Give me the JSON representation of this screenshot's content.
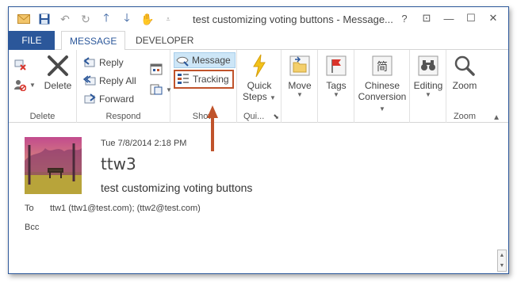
{
  "window": {
    "title": "test customizing voting buttons - Message...",
    "controls": [
      "?",
      "⊡",
      "—",
      "☐",
      "✕"
    ]
  },
  "tabs": [
    {
      "label": "FILE"
    },
    {
      "label": "MESSAGE"
    },
    {
      "label": "DEVELOPER"
    }
  ],
  "ribbon": {
    "delete_group": {
      "label": "Delete",
      "delete_button": "Delete"
    },
    "respond_group": {
      "label": "Respond",
      "reply": "Reply",
      "reply_all": "Reply All",
      "forward": "Forward"
    },
    "show_group": {
      "label": "Show",
      "message": "Message",
      "tracking": "Tracking"
    },
    "quicksteps_group": {
      "label": "Qui...",
      "quick": "Quick",
      "steps": "Steps"
    },
    "move": {
      "label": "Move"
    },
    "tags": {
      "label": "Tags"
    },
    "chinese": {
      "line1": "Chinese",
      "line2": "Conversion"
    },
    "editing": {
      "label": "Editing"
    },
    "zoom_group": {
      "label": "Zoom",
      "zoom_button": "Zoom"
    }
  },
  "message": {
    "date": "Tue 7/8/2014 2:18 PM",
    "sender": "ttw3",
    "subject": "test customizing voting buttons",
    "to_label": "To",
    "to_value": "ttw1 (ttw1@test.com);  (ttw2@test.com)",
    "bcc_label": "Bcc"
  },
  "colors": {
    "accent": "#2b579a",
    "annotation": "#c0532b"
  }
}
